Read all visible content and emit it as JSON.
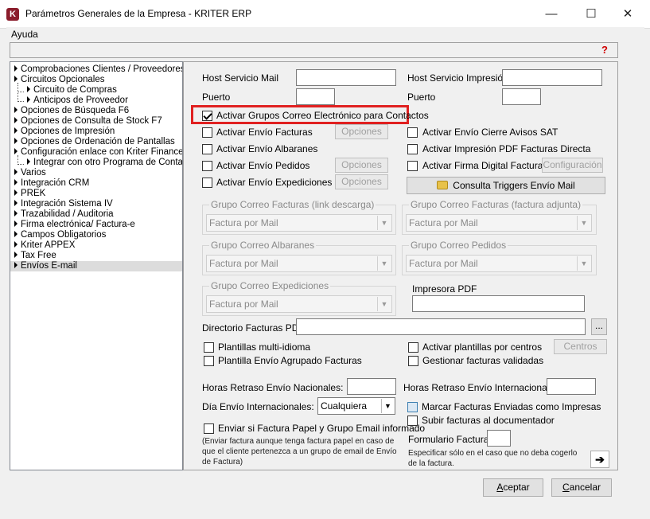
{
  "window": {
    "title": "Parámetros Generales de la Empresa - KRITER ERP",
    "minimize": "—",
    "maximize": "☐",
    "close": "✕",
    "icon": "kriter-app-icon"
  },
  "menu": {
    "ayuda": "Ayuda"
  },
  "tree": [
    {
      "label": "Comprobaciones Clientes / Proveedores"
    },
    {
      "label": "Circuitos Opcionales"
    },
    {
      "label": "Circuito de Compras"
    },
    {
      "label": "Anticipos de Proveedor"
    },
    {
      "label": "Opciones de Búsqueda F6"
    },
    {
      "label": "Opciones de Consulta de Stock F7"
    },
    {
      "label": "Opciones de Impresión"
    },
    {
      "label": "Opciones de Ordenación de Pantallas"
    },
    {
      "label": "Configuración enlace con Kriter Finances"
    },
    {
      "label": "Integrar con otro Programa de Contabilidad"
    },
    {
      "label": "Varios"
    },
    {
      "label": "Integración CRM"
    },
    {
      "label": "PREK"
    },
    {
      "label": "Integración Sistema IV"
    },
    {
      "label": "Trazabilidad / Auditoria"
    },
    {
      "label": "Firma electrónica/ Factura-e"
    },
    {
      "label": "Campos Obligatorios"
    },
    {
      "label": "Kriter APPEX"
    },
    {
      "label": "Tax Free"
    },
    {
      "label": "Envíos E-mail"
    }
  ],
  "main": {
    "host_mail": "Host Servicio Mail",
    "host_mail_value": "",
    "puerto": "Puerto",
    "puerto_value": "",
    "host_impresion": "Host Servicio Impresión",
    "host_impresion_value": "",
    "puerto2": "Puerto",
    "puerto2_value": "",
    "activar_grupos": "Activar Grupos Correo Electrónico para Contactos",
    "activar_envio_facturas": "Activar Envío Facturas",
    "activar_envio_albaranes": "Activar Envío Albaranes",
    "activar_envio_pedidos": "Activar Envío Pedidos",
    "activar_envio_expediciones": "Activar Envío Expediciones",
    "opciones": "Opciones",
    "cierre_avisos": "Activar Envío Cierre Avisos SAT",
    "impresion_pdf": "Activar Impresión PDF Facturas Directa",
    "firma_digital": "Activar Firma Digital Facturas",
    "configuracion": "Configuración",
    "consulta_triggers": "Consulta Triggers Envío Mail",
    "g_fact_link": "Grupo Correo Facturas (link descarga)",
    "g_fact_adj": "Grupo Correo Facturas (factura adjunta)",
    "g_albaranes": "Grupo Correo Albaranes",
    "g_pedidos": "Grupo Correo Pedidos",
    "g_expediciones": "Grupo Correo Expediciones",
    "factura_por_mail": "Factura por Mail",
    "impresora_pdf": "Impresora PDF",
    "impresora_pdf_value": "",
    "dir_facturas": "Directorio Facturas PDF",
    "dir_facturas_value": "",
    "browse": "...",
    "plantillas_multi": "Plantillas multi-idioma",
    "plantilla_agrupado": "Plantilla Envío Agrupado Facturas",
    "activar_plantillas": "Activar plantillas por centros",
    "centros": "Centros",
    "gestionar_validadas": "Gestionar facturas validadas",
    "horas_nac": "Horas Retraso Envío Nacionales:",
    "horas_nac_value": "",
    "horas_int": "Horas Retraso Envío Internacionales:",
    "horas_int_value": "",
    "dia_int": "Día Envío Internacionales:",
    "dia_int_value": "Cualquiera",
    "enviar_papel": "Enviar si Factura Papel y Grupo Email informado",
    "enviar_papel_note": "(Enviar factura aunque tenga factura papel en caso de que el cliente pertenezca a un grupo de email de Envío de Factura)",
    "marcar_impresas": "Marcar Facturas Enviadas como Impresas",
    "subir_documentador": "Subir facturas al documentador",
    "formulario_facturas": "Formulario Facturas",
    "formulario_value": "",
    "formulario_note": "Especificar sólo en el caso que no deba cogerlo de la factura.",
    "arrow_btn": "➔"
  },
  "buttons": {
    "aceptar_a": "A",
    "aceptar_rest": "ceptar",
    "cancelar_c": "C",
    "cancelar_rest": "ancelar"
  },
  "colors": {
    "highlight_border": "#e02020",
    "help_icon": "#d00000"
  }
}
